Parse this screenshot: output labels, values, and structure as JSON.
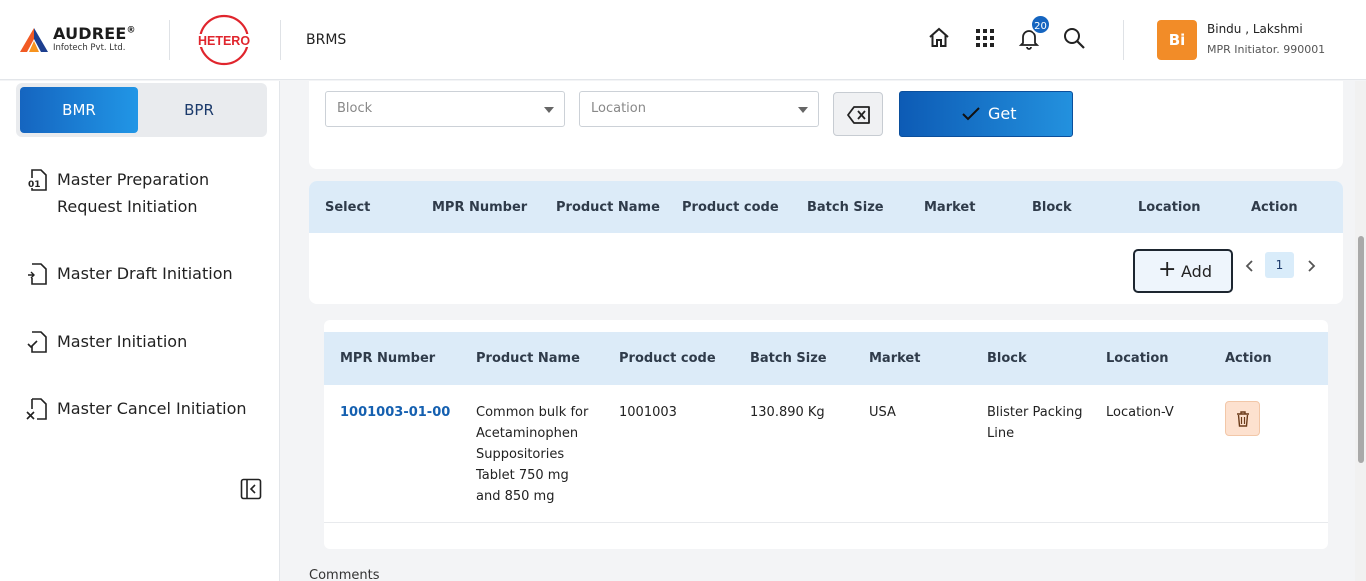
{
  "header": {
    "logo_name": "AUDREE",
    "logo_reg": "®",
    "logo_sub": "Infotech Pvt. Ltd.",
    "partner_logo": "HETERO",
    "app_title": "BRMS",
    "notification_count": "20",
    "user_initials": "Bi",
    "user_name": "Bindu , Lakshmi",
    "user_role": "MPR Initiator. 990001",
    "icons": [
      "home-icon",
      "apps-grid-icon",
      "bell-icon",
      "search-icon"
    ]
  },
  "sidebar": {
    "tabs": [
      {
        "label": "BMR",
        "active": true
      },
      {
        "label": "BPR",
        "active": false
      }
    ],
    "items": [
      {
        "label": "Master Preparation Request Initiation",
        "icon": "document-01-icon"
      },
      {
        "label": "Master Draft Initiation",
        "icon": "document-edit-icon"
      },
      {
        "label": "Master Initiation",
        "icon": "document-check-icon"
      },
      {
        "label": "Master Cancel Initiation",
        "icon": "document-cancel-icon"
      }
    ]
  },
  "filters": {
    "block_placeholder": "Block",
    "location_placeholder": "Location",
    "get_label": "Get"
  },
  "list_table": {
    "headers": [
      "Select",
      "MPR Number",
      "Product Name",
      "Product code",
      "Batch Size",
      "Market",
      "Block",
      "Location",
      "Action"
    ],
    "add_label": "Add",
    "page": "1"
  },
  "selected_table": {
    "headers": [
      "MPR Number",
      "Product Name",
      "Product code",
      "Batch Size",
      "Market",
      "Block",
      "Location",
      "Action"
    ],
    "rows": [
      {
        "mpr_number": "1001003-01-00",
        "product_name": "Common bulk for Acetaminophen Suppositories Tablet 750 mg and 850 mg",
        "product_code": "1001003",
        "batch_size": "130.890 Kg",
        "market": "USA",
        "block": "Blister Packing Line",
        "location": "Location-V"
      }
    ]
  },
  "comments_label": "Comments",
  "colors": {
    "primary": "#1565c0",
    "header_row": "#dcebf8",
    "avatar": "#f28c28",
    "delete_bg": "#fde1cf"
  }
}
